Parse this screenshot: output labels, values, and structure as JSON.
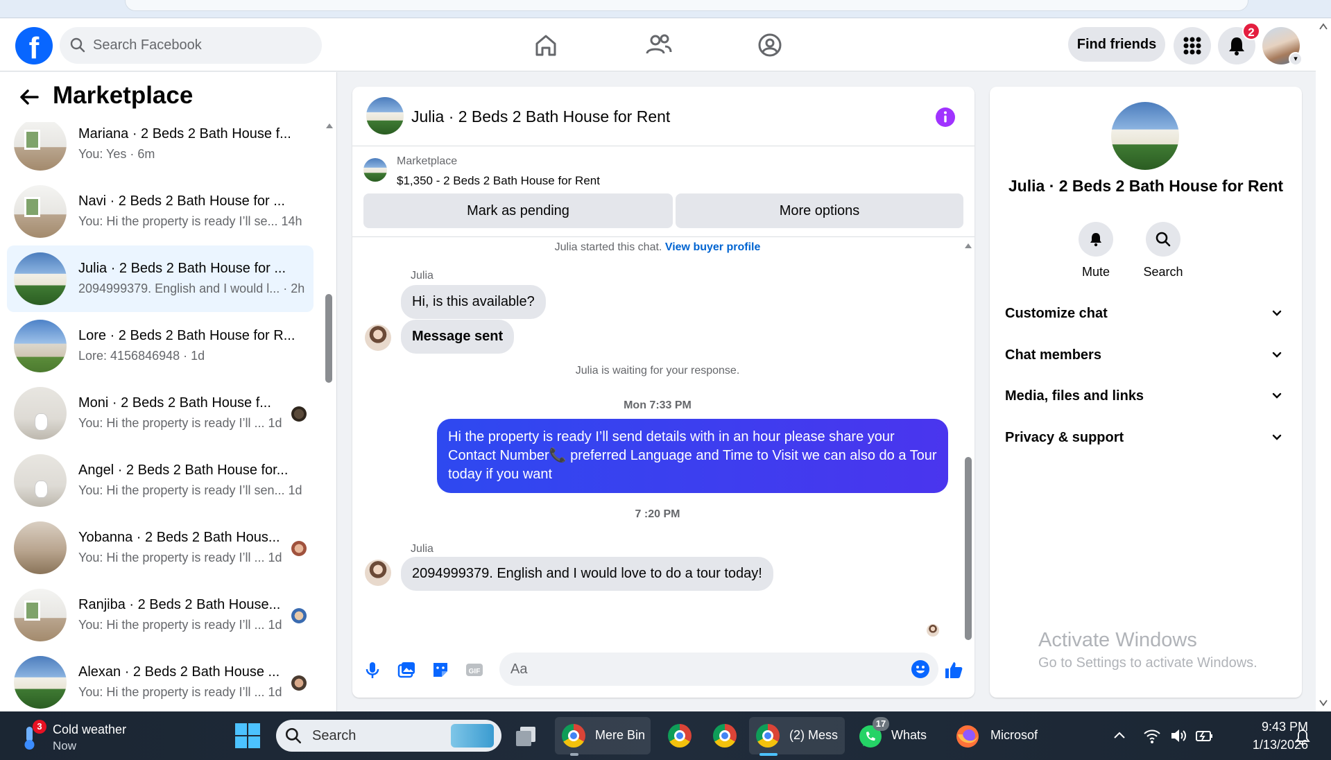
{
  "browser": {},
  "topbar": {
    "search_placeholder": "Search Facebook",
    "find_friends": "Find friends",
    "notification_count": "2",
    "logo": "f"
  },
  "sidebar": {
    "title": "Marketplace",
    "conversations": [
      {
        "name": "Mariana · 2 Beds 2 Bath House f...",
        "last": "You: Yes · 6m",
        "avatar": "room"
      },
      {
        "name": "Navi · 2 Beds 2 Bath House for ...",
        "last": "You: Hi the property is ready I’ll se... 14h",
        "avatar": "room"
      },
      {
        "name": "Julia · 2 Beds 2 Bath House for ...",
        "last": "2094999379. English and I would l... · 2h",
        "avatar": "house",
        "active": true
      },
      {
        "name": "Lore · 2 Beds 2 Bath House for R...",
        "last": "Lore: 4156846948 · 1d",
        "avatar": "lore"
      },
      {
        "name": "Moni · 2 Beds 2 Bath House f...",
        "last": "You: Hi the property is ready I’ll ... 1d",
        "avatar": "bath"
      },
      {
        "name": "Angel · 2 Beds 2 Bath House for...",
        "last": "You: Hi the property is ready I’ll sen... 1d",
        "avatar": "bath"
      },
      {
        "name": "Yobanna · 2 Beds 2 Bath Hous...",
        "last": "You: Hi the property is ready I’ll ... 1d",
        "avatar": "tan"
      },
      {
        "name": "Ranjiba · 2 Beds 2 Bath House...",
        "last": "You: Hi the property is ready I’ll ... 1d",
        "avatar": "room"
      },
      {
        "name": "Alexan · 2 Beds 2 Bath House ...",
        "last": "You: Hi the property is ready I’ll ... 1d",
        "avatar": "house"
      }
    ]
  },
  "chat": {
    "title": "Julia · 2 Beds 2 Bath House for Rent",
    "listing_source": "Marketplace",
    "listing_price": "$1,350 - 2 Beds 2 Bath House for Rent",
    "mark_pending": "Mark as pending",
    "more_options": "More options",
    "started_text": "Julia started this chat.",
    "buyer_profile_link": "View buyer profile",
    "sender1": "Julia",
    "msg1": "Hi, is this available?",
    "msg2": "Message sent",
    "waiting": "Julia is waiting for your response.",
    "stamp1": "Mon 7:33 PM",
    "out_msg": "Hi the property is ready I’ll send details with in an hour please share your Contact Number📞 preferred Language and Time to Visit we can also do a Tour today if you want",
    "stamp2": "7 :20 PM",
    "sender2": "Julia",
    "msg3": "2094999379. English and I would love to do a tour today!",
    "composer_placeholder": "Aa"
  },
  "details": {
    "title": "Julia · 2 Beds 2 Bath House for Rent",
    "mute": "Mute",
    "search": "Search",
    "rows": [
      "Customize chat",
      "Chat members",
      "Media, files and links",
      "Privacy & support"
    ],
    "activate_title": "Activate Windows",
    "activate_sub": "Go to Settings to activate Windows."
  },
  "taskbar": {
    "weather_title": "Cold weather",
    "weather_sub": "Now",
    "weather_badge": "3",
    "search": "Search",
    "app1": "Mere Bin",
    "app2": "(2) Mess",
    "whatsapp": "Whats",
    "whatsapp_badge": "17",
    "firefox": "Microsof",
    "time": "9:43 PM",
    "date": "1/13/2026"
  },
  "colors": {
    "facebook_blue": "#0866ff",
    "outgoing_bubble": "#3d3df0",
    "info_purple": "#a033ff",
    "badge_red": "#e41e3f"
  }
}
